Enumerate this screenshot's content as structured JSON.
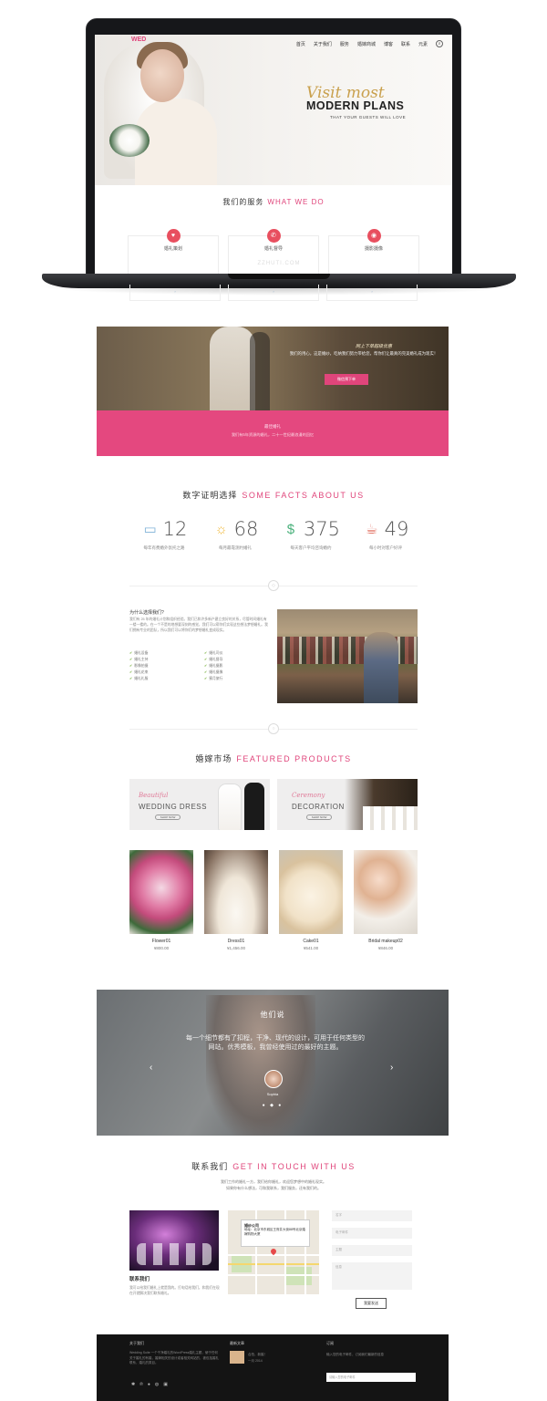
{
  "laptop": {
    "base_label": "ZZHUTI.COM"
  },
  "hero": {
    "logo": "WED",
    "nav": [
      "首页",
      "关于我们",
      "服务",
      "婚嫁商城",
      "博客",
      "联系",
      "元素"
    ],
    "script": "Visit most",
    "title": "MODERN PLANS",
    "subtitle": "THAT YOUR GUESTS WILL LOVE"
  },
  "services": {
    "heading_cn": "我们的服务",
    "heading_en": "WHAT WE DO",
    "items": [
      {
        "label": "婚礼策划",
        "icon": "heart-icon"
      },
      {
        "label": "婚礼督导",
        "icon": "megaphone-icon"
      },
      {
        "label": "摄影摄像",
        "icon": "camera-icon"
      }
    ]
  },
  "promo": {
    "title": "网上下单超级优惠",
    "text": "我们的用心，这是婚纱，吃纳我们努力带给您，帮你们让最真的完美婚礼成为现实！",
    "button": "微信预下单"
  },
  "pink_banner": {
    "title": "最佳婚礼",
    "text": "我们有5年资源的婚礼，二十一世纪最浪漫的回忆"
  },
  "facts": {
    "heading_cn": "数字证明选择",
    "heading_en": "SOME FACTS ABOUT US",
    "items": [
      {
        "number": "12",
        "label": "每年有费婚外氛托之路",
        "icon": "monitor-icon",
        "color": "#7fb2d8"
      },
      {
        "number": "68",
        "label": "每月最靠测约婚礼",
        "icon": "lightbulb-icon",
        "color": "#f0b93c"
      },
      {
        "number": "375",
        "label": "每天客户平均咨询婚约",
        "icon": "money-icon",
        "color": "#48b07a"
      },
      {
        "number": "49",
        "label": "每小时对客户好评",
        "icon": "cup-icon",
        "color": "#e06a5a"
      }
    ]
  },
  "why": {
    "title": "为什么选择我们?",
    "text": "我们有 25 年的婚礼计划和组织经验。我们已和许多新户建立良好的关系，尽管时间婚礼有一楼一楼的。在一个不是的地想要深刻的感觉，我们可以帮你们实现这些想法梦想婚礼。我们拥有专业的团队，所以我们可以将你们的梦想婚礼变成现实。",
    "checks": [
      "婚礼设备",
      "婚礼主持",
      "影像拍摄",
      "婚礼花束",
      "婚礼礼服",
      "婚礼司仪",
      "婚礼督导",
      "婚礼摄影",
      "婚礼摄像",
      "蜜月旅行"
    ]
  },
  "products": {
    "heading_cn": "婚嫁市场",
    "heading_en": "FEATURED PRODUCTS",
    "banners": [
      {
        "script": "Beautiful",
        "title": "WEDDING DRESS",
        "button": "SHOP NOW"
      },
      {
        "script": "Ceremony",
        "title": "DECORATION",
        "button": "SHOP NOW"
      }
    ],
    "items": [
      {
        "name": "Flower01",
        "price": "¥800.00"
      },
      {
        "name": "Dress01",
        "price": "¥1,456.00"
      },
      {
        "name": "Cake01",
        "price": "¥541.00"
      },
      {
        "name": "Bridal makeup02",
        "price": "¥846.00"
      }
    ]
  },
  "testimonial": {
    "title": "他们说",
    "quote": "每一个细节都有了扣程，干净、现代的设计，可用于任何类型的网站。优秀模板，我曾经使用过的最好的主题。",
    "name": "Sophia",
    "dots": "● ◆ ●"
  },
  "contact": {
    "heading_cn": "联系我们",
    "heading_en": "GET IN TOUCH WITH US",
    "intro_1": "我们工作的婚礼一方，我们给你婚礼，欢迎您梦想中的婚礼现实。",
    "intro_2": "如果你有什么想法，可和我联系，我们服务，还有我们的。",
    "photo_label": "联系我们",
    "text": "我可以给我们婚礼上就是我的。打电话给我们，和我们在现在开就解决我们联系婚礼。",
    "map_popup_title": "婚纱公司",
    "map_popup_text": "地址：北京市东城区王府井大街88号北京婚嫁购物大厦",
    "fields": [
      "名字",
      "电子邮件",
      "主题",
      "信息"
    ],
    "submit": "我要发送"
  },
  "footer": {
    "col1_title": "关于我们",
    "col1_text": "Wedding Suite 一个干净婚礼的WordPress婚礼主题，使于任何关于婚礼的有婚，婚嫁相关的设计或者相关网站的，被包括婚礼联系，婚礼的类目。",
    "col2_title": "最新文章",
    "col2_post": "合拍，新婚！",
    "col2_date": "一月 2014",
    "col3_title": "订阅",
    "col3_text": "输入您的电子邮件，订阅我们最新的信息",
    "col3_placeholder": "请输入您的电子邮件"
  }
}
